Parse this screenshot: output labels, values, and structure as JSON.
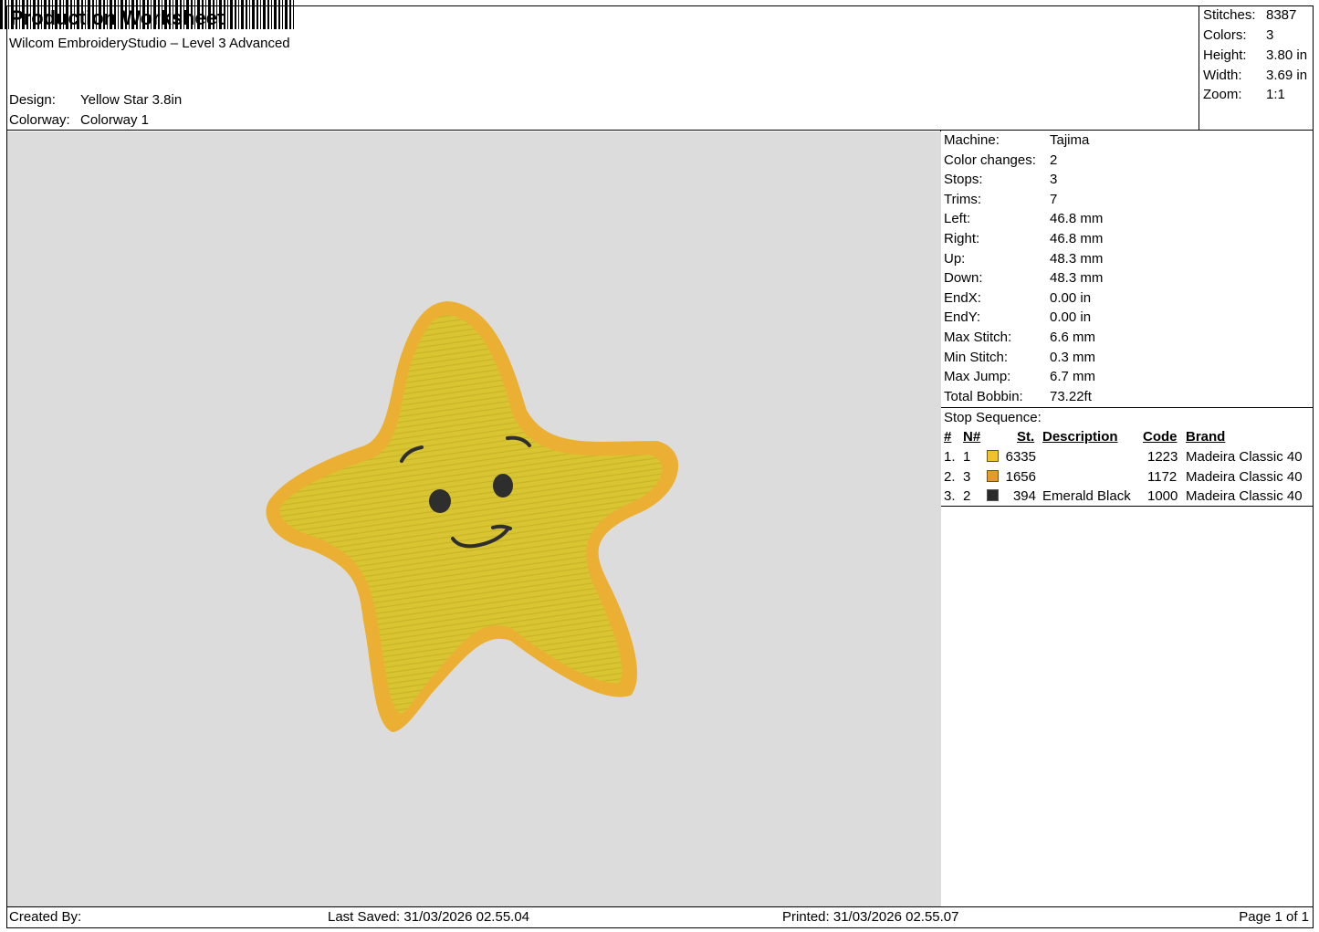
{
  "header": {
    "title": "Production Worksheet",
    "software": "Wilcom EmbroideryStudio – Level 3 Advanced",
    "design_label": "Design:",
    "design_value": "Yellow Star 3.8in",
    "colorway_label": "Colorway:",
    "colorway_value": "Colorway 1"
  },
  "summary": [
    {
      "label": "Stitches:",
      "value": "8387"
    },
    {
      "label": "Colors:",
      "value": "3"
    },
    {
      "label": "Height:",
      "value": "3.80 in"
    },
    {
      "label": "Width:",
      "value": "3.69 in"
    },
    {
      "label": "Zoom:",
      "value": "1:1"
    }
  ],
  "machine_info": [
    {
      "label": "Machine:",
      "value": "Tajima"
    },
    {
      "label": "Color changes:",
      "value": "2"
    },
    {
      "label": "Stops:",
      "value": "3"
    },
    {
      "label": "Trims:",
      "value": "7"
    },
    {
      "label": "Left:",
      "value": "46.8 mm"
    },
    {
      "label": "Right:",
      "value": "46.8 mm"
    },
    {
      "label": "Up:",
      "value": "48.3 mm"
    },
    {
      "label": "Down:",
      "value": "48.3 mm"
    },
    {
      "label": "EndX:",
      "value": "0.00 in"
    },
    {
      "label": "EndY:",
      "value": "0.00 in"
    },
    {
      "label": "Max Stitch:",
      "value": "6.6 mm"
    },
    {
      "label": "Min Stitch:",
      "value": "0.3 mm"
    },
    {
      "label": "Max Jump:",
      "value": "6.7 mm"
    },
    {
      "label": "Total Bobbin:",
      "value": "73.22ft"
    }
  ],
  "stop_sequence": {
    "title": "Stop Sequence:",
    "headers": {
      "num": "#",
      "n": "N#",
      "st": "St.",
      "description": "Description",
      "code": "Code",
      "brand": "Brand"
    },
    "rows": [
      {
        "num": "1.",
        "n": "1",
        "color": "#f2c12e",
        "st": "6335",
        "description": "",
        "code": "1223",
        "brand": "Madeira Classic 40"
      },
      {
        "num": "2.",
        "n": "3",
        "color": "#e8992b",
        "st": "1656",
        "description": "",
        "code": "1172",
        "brand": "Madeira Classic 40"
      },
      {
        "num": "3.",
        "n": "2",
        "color": "#2a2a2a",
        "st": "394",
        "description": "Emerald Black",
        "code": "1000",
        "brand": "Madeira Classic 40"
      }
    ]
  },
  "design_colors": {
    "fill": "#d9c431",
    "border": "#ebb033",
    "face": "#2e2e2e",
    "background": "#dcdcdc"
  },
  "footer": {
    "created_by": "Created By:",
    "last_saved": "Last Saved: 31/03/2026 02.55.04",
    "printed": "Printed: 31/03/2026 02.55.07",
    "page": "Page 1 of 1"
  }
}
